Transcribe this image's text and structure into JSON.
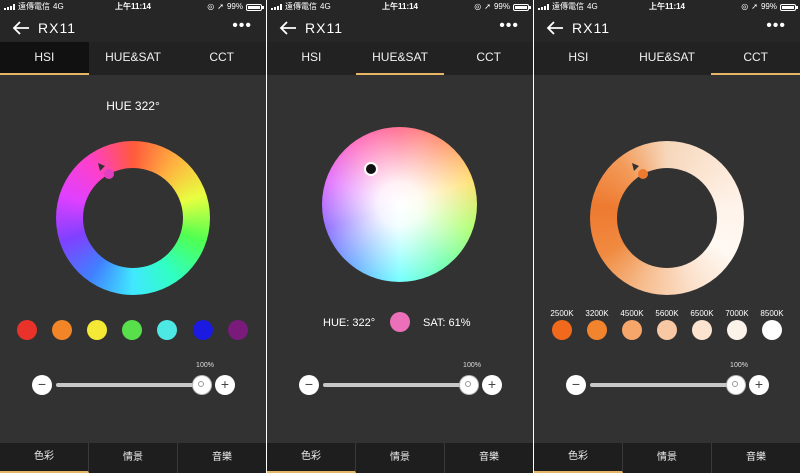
{
  "status": {
    "carrier": "遠傳電信",
    "network": "4G",
    "time": "上午11:14",
    "battery": "99%"
  },
  "app": {
    "title": "RX11"
  },
  "tabs": [
    {
      "label": "HSI"
    },
    {
      "label": "HUE&SAT"
    },
    {
      "label": "CCT"
    }
  ],
  "bottom_nav": [
    {
      "label": "色彩"
    },
    {
      "label": "情景"
    },
    {
      "label": "音樂"
    }
  ],
  "screens": [
    {
      "active_tab": "HSI",
      "hue_label": "HUE 322°",
      "hue_degrees": 322,
      "preset_colors": [
        "#e8322a",
        "#f18527",
        "#f4ea35",
        "#57e04b",
        "#4ee8e4",
        "#1a1ae0",
        "#7a1a7a"
      ],
      "intensity": {
        "label": "100%",
        "value": 1.0
      }
    },
    {
      "active_tab": "HUE&SAT",
      "hue_text": "HUE: 322°",
      "sat_text": "SAT: 61%",
      "hue_degrees": 322,
      "saturation": 0.61,
      "swatch_color": "#ec6fb9",
      "intensity": {
        "label": "100%",
        "value": 1.0
      }
    },
    {
      "active_tab": "CCT",
      "kelvin_presets": [
        {
          "label": "2500K",
          "color": "#f0691c"
        },
        {
          "label": "3200K",
          "color": "#f2842e"
        },
        {
          "label": "4500K",
          "color": "#f6a56b"
        },
        {
          "label": "5600K",
          "color": "#f8c7a3"
        },
        {
          "label": "6500K",
          "color": "#fbe3cf"
        },
        {
          "label": "7000K",
          "color": "#fbf3ea"
        },
        {
          "label": "8500K",
          "color": "#ffffff"
        }
      ],
      "intensity": {
        "label": "100%",
        "value": 1.0
      }
    }
  ],
  "colors": {
    "accent": "#e6b566",
    "background": "#323232",
    "bar": "#262626"
  }
}
